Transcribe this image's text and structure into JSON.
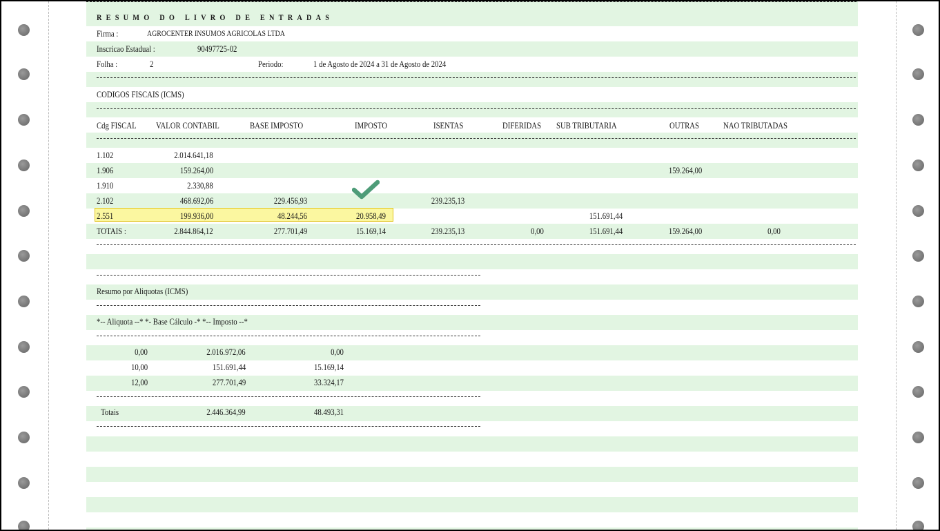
{
  "report": {
    "title": "RESUMO DO LIVRO DE ENTRADAS",
    "firma_label": "Firma :",
    "firma_value": "AGROCENTER INSUMOS AGRICOLAS LTDA",
    "inscricao_label": "Inscricao Estadual :",
    "inscricao_value": "90497725-02",
    "folha_label": "Folha :",
    "folha_value": "2",
    "periodo_label": "Periodo:",
    "periodo_value": "1 de Agosto de 2024 a 31 de Agosto de 2024"
  },
  "codigos": {
    "section_title": "CODIGOS FISCAIS (ICMS)",
    "headers": [
      "Cdg FISCAL",
      "VALOR CONTABIL",
      "BASE IMPOSTO",
      "IMPOSTO",
      "ISENTAS",
      "DIFERIDAS",
      "SUB TRIBUTARIA",
      "OUTRAS",
      "NAO TRIBUTADAS"
    ],
    "rows": [
      [
        "1.102",
        "2.014.641,18",
        "",
        "",
        "",
        "",
        "",
        "",
        ""
      ],
      [
        "1.906",
        "159.264,00",
        "",
        "",
        "",
        "",
        "",
        "159.264,00",
        ""
      ],
      [
        "1.910",
        "2.330,88",
        "",
        "",
        "",
        "",
        "",
        "",
        ""
      ],
      [
        "2.102",
        "468.692,06",
        "229.456,93",
        "",
        "239.235,13",
        "",
        "",
        "",
        ""
      ],
      [
        "2.551",
        "199.936,00",
        "48.244,56",
        "20.958,49",
        "",
        "",
        "151.691,44",
        "",
        ""
      ]
    ],
    "totals": [
      "TOTAIS :",
      "2.844.864,12",
      "277.701,49",
      "15.169,14",
      "239.235,13",
      "0,00",
      "151.691,44",
      "159.264,00",
      "0,00"
    ],
    "highlighted_row": 4
  },
  "aliquotas": {
    "section_title": "Resumo por Aliquotas (ICMS)",
    "header": "*-- Aliquota --* *- Base Cálculo -* *-- Imposto --*",
    "rows": [
      [
        "0,00",
        "2.016.972,06",
        "0,00"
      ],
      [
        "10,00",
        "151.691,44",
        "15.169,14"
      ],
      [
        "12,00",
        "277.701,49",
        "33.324,17"
      ]
    ],
    "totals_label": "Totais",
    "totals_base": "2.446.364,99",
    "totals_imposto": "48.493,31"
  },
  "colors": {
    "stripe_green": "#e2f5e2",
    "highlight_fill": "#fbf7a0",
    "highlight_border": "#e0c21a",
    "check_green": "#4e9c78"
  },
  "icons": [
    "checkmark-icon",
    "tractor-feed-hole"
  ]
}
